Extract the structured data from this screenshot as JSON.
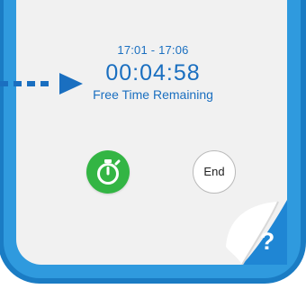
{
  "session": {
    "time_range": "17:01 - 17:06",
    "countdown": "00:04:58",
    "countdown_label": "Free Time Remaining"
  },
  "controls": {
    "timer_icon": "stopwatch-icon",
    "end_label": "End"
  },
  "help": {
    "mark": "?",
    "icon": "page-curl-help-icon"
  },
  "colors": {
    "frame_blue": "#1a7cc4",
    "frame_ring_blue": "#2f9ade",
    "screen_background": "#f1f1f1",
    "text_blue": "#1a6fc0",
    "pointer_blue": "#1a6fc0",
    "timer_green": "#33b544",
    "help_blue": "#1f86d4"
  }
}
